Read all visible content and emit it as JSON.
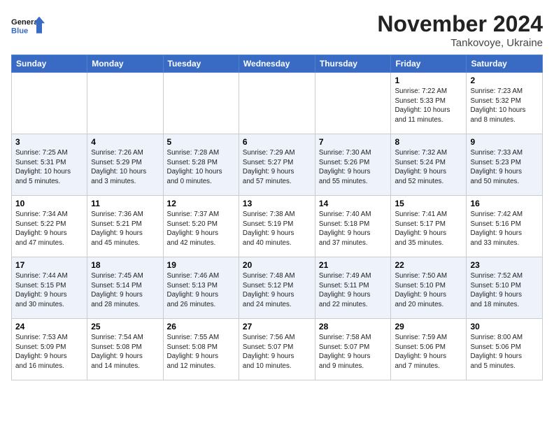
{
  "header": {
    "logo_line1": "General",
    "logo_line2": "Blue",
    "month": "November 2024",
    "location": "Tankovoye, Ukraine"
  },
  "weekdays": [
    "Sunday",
    "Monday",
    "Tuesday",
    "Wednesday",
    "Thursday",
    "Friday",
    "Saturday"
  ],
  "weeks": [
    [
      {
        "day": "",
        "info": ""
      },
      {
        "day": "",
        "info": ""
      },
      {
        "day": "",
        "info": ""
      },
      {
        "day": "",
        "info": ""
      },
      {
        "day": "",
        "info": ""
      },
      {
        "day": "1",
        "info": "Sunrise: 7:22 AM\nSunset: 5:33 PM\nDaylight: 10 hours\nand 11 minutes."
      },
      {
        "day": "2",
        "info": "Sunrise: 7:23 AM\nSunset: 5:32 PM\nDaylight: 10 hours\nand 8 minutes."
      }
    ],
    [
      {
        "day": "3",
        "info": "Sunrise: 7:25 AM\nSunset: 5:31 PM\nDaylight: 10 hours\nand 5 minutes."
      },
      {
        "day": "4",
        "info": "Sunrise: 7:26 AM\nSunset: 5:29 PM\nDaylight: 10 hours\nand 3 minutes."
      },
      {
        "day": "5",
        "info": "Sunrise: 7:28 AM\nSunset: 5:28 PM\nDaylight: 10 hours\nand 0 minutes."
      },
      {
        "day": "6",
        "info": "Sunrise: 7:29 AM\nSunset: 5:27 PM\nDaylight: 9 hours\nand 57 minutes."
      },
      {
        "day": "7",
        "info": "Sunrise: 7:30 AM\nSunset: 5:26 PM\nDaylight: 9 hours\nand 55 minutes."
      },
      {
        "day": "8",
        "info": "Sunrise: 7:32 AM\nSunset: 5:24 PM\nDaylight: 9 hours\nand 52 minutes."
      },
      {
        "day": "9",
        "info": "Sunrise: 7:33 AM\nSunset: 5:23 PM\nDaylight: 9 hours\nand 50 minutes."
      }
    ],
    [
      {
        "day": "10",
        "info": "Sunrise: 7:34 AM\nSunset: 5:22 PM\nDaylight: 9 hours\nand 47 minutes."
      },
      {
        "day": "11",
        "info": "Sunrise: 7:36 AM\nSunset: 5:21 PM\nDaylight: 9 hours\nand 45 minutes."
      },
      {
        "day": "12",
        "info": "Sunrise: 7:37 AM\nSunset: 5:20 PM\nDaylight: 9 hours\nand 42 minutes."
      },
      {
        "day": "13",
        "info": "Sunrise: 7:38 AM\nSunset: 5:19 PM\nDaylight: 9 hours\nand 40 minutes."
      },
      {
        "day": "14",
        "info": "Sunrise: 7:40 AM\nSunset: 5:18 PM\nDaylight: 9 hours\nand 37 minutes."
      },
      {
        "day": "15",
        "info": "Sunrise: 7:41 AM\nSunset: 5:17 PM\nDaylight: 9 hours\nand 35 minutes."
      },
      {
        "day": "16",
        "info": "Sunrise: 7:42 AM\nSunset: 5:16 PM\nDaylight: 9 hours\nand 33 minutes."
      }
    ],
    [
      {
        "day": "17",
        "info": "Sunrise: 7:44 AM\nSunset: 5:15 PM\nDaylight: 9 hours\nand 30 minutes."
      },
      {
        "day": "18",
        "info": "Sunrise: 7:45 AM\nSunset: 5:14 PM\nDaylight: 9 hours\nand 28 minutes."
      },
      {
        "day": "19",
        "info": "Sunrise: 7:46 AM\nSunset: 5:13 PM\nDaylight: 9 hours\nand 26 minutes."
      },
      {
        "day": "20",
        "info": "Sunrise: 7:48 AM\nSunset: 5:12 PM\nDaylight: 9 hours\nand 24 minutes."
      },
      {
        "day": "21",
        "info": "Sunrise: 7:49 AM\nSunset: 5:11 PM\nDaylight: 9 hours\nand 22 minutes."
      },
      {
        "day": "22",
        "info": "Sunrise: 7:50 AM\nSunset: 5:10 PM\nDaylight: 9 hours\nand 20 minutes."
      },
      {
        "day": "23",
        "info": "Sunrise: 7:52 AM\nSunset: 5:10 PM\nDaylight: 9 hours\nand 18 minutes."
      }
    ],
    [
      {
        "day": "24",
        "info": "Sunrise: 7:53 AM\nSunset: 5:09 PM\nDaylight: 9 hours\nand 16 minutes."
      },
      {
        "day": "25",
        "info": "Sunrise: 7:54 AM\nSunset: 5:08 PM\nDaylight: 9 hours\nand 14 minutes."
      },
      {
        "day": "26",
        "info": "Sunrise: 7:55 AM\nSunset: 5:08 PM\nDaylight: 9 hours\nand 12 minutes."
      },
      {
        "day": "27",
        "info": "Sunrise: 7:56 AM\nSunset: 5:07 PM\nDaylight: 9 hours\nand 10 minutes."
      },
      {
        "day": "28",
        "info": "Sunrise: 7:58 AM\nSunset: 5:07 PM\nDaylight: 9 hours\nand 9 minutes."
      },
      {
        "day": "29",
        "info": "Sunrise: 7:59 AM\nSunset: 5:06 PM\nDaylight: 9 hours\nand 7 minutes."
      },
      {
        "day": "30",
        "info": "Sunrise: 8:00 AM\nSunset: 5:06 PM\nDaylight: 9 hours\nand 5 minutes."
      }
    ]
  ]
}
